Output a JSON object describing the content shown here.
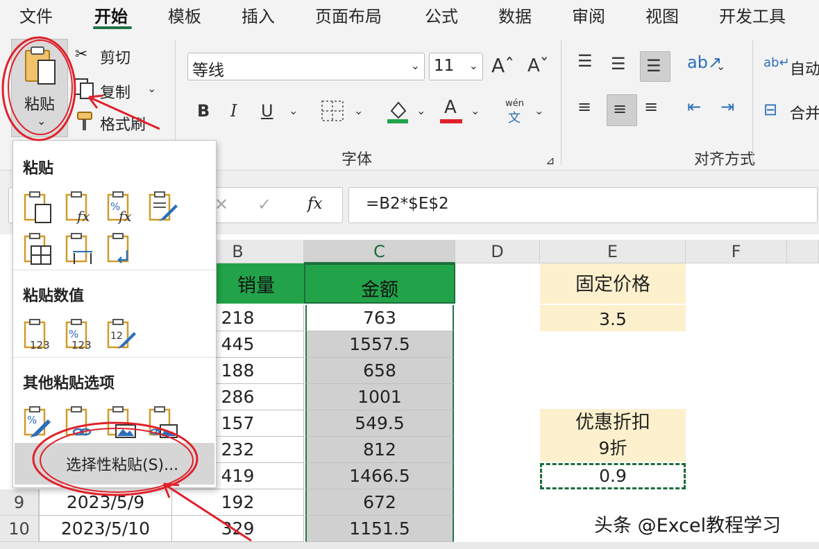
{
  "tabs": [
    "文件",
    "开始",
    "模板",
    "插入",
    "页面布局",
    "公式",
    "数据",
    "审阅",
    "视图",
    "开发工具"
  ],
  "clipboard": {
    "paste_label": "粘贴",
    "cut_label": "剪切",
    "copy_label": "复制",
    "format_painter_label": "格式刷"
  },
  "font": {
    "font_name": "等线",
    "font_size": "11",
    "group_label": "字体",
    "wen_label": "wén",
    "wen_char": "文"
  },
  "alignment": {
    "group_label": "对齐方式",
    "wrap_label": "自动",
    "merge_label": "合并"
  },
  "formula_bar": {
    "formula": "=B2*$E$2"
  },
  "columns": [
    "B",
    "C",
    "D",
    "E",
    "F"
  ],
  "table": {
    "header_b": "销量",
    "header_c": "金额",
    "rows": [
      {
        "row": "",
        "a": "",
        "b": "218",
        "c": "763"
      },
      {
        "row": "",
        "a": "",
        "b": "445",
        "c": "1557.5"
      },
      {
        "row": "",
        "a": "",
        "b": "188",
        "c": "658"
      },
      {
        "row": "",
        "a": "",
        "b": "286",
        "c": "1001"
      },
      {
        "row": "",
        "a": "",
        "b": "157",
        "c": "549.5"
      },
      {
        "row": "",
        "a": "",
        "b": "232",
        "c": "812"
      },
      {
        "row": "",
        "a": "",
        "b": "419",
        "c": "1466.5"
      },
      {
        "row": "9",
        "a": "2023/5/9",
        "b": "192",
        "c": "672"
      },
      {
        "row": "10",
        "a": "2023/5/10",
        "b": "329",
        "c": "1151.5"
      }
    ]
  },
  "side_cells": {
    "fixed_price_label": "固定价格",
    "fixed_price_value": "3.5",
    "discount_label": "优惠折扣",
    "discount_text": "9折",
    "discount_value": "0.9"
  },
  "paste_menu": {
    "section_paste": "粘贴",
    "section_values": "粘贴数值",
    "section_other": "其他粘贴选项",
    "paste_special_label": "选择性粘贴(S)...",
    "values_123": "123"
  },
  "watermark": "头条 @Excel教程学习",
  "colors": {
    "accent_green": "#217346",
    "header_fill": "#22a34a",
    "highlight_yellow": "#fdf0cd",
    "annotation_red": "#e0202a"
  }
}
